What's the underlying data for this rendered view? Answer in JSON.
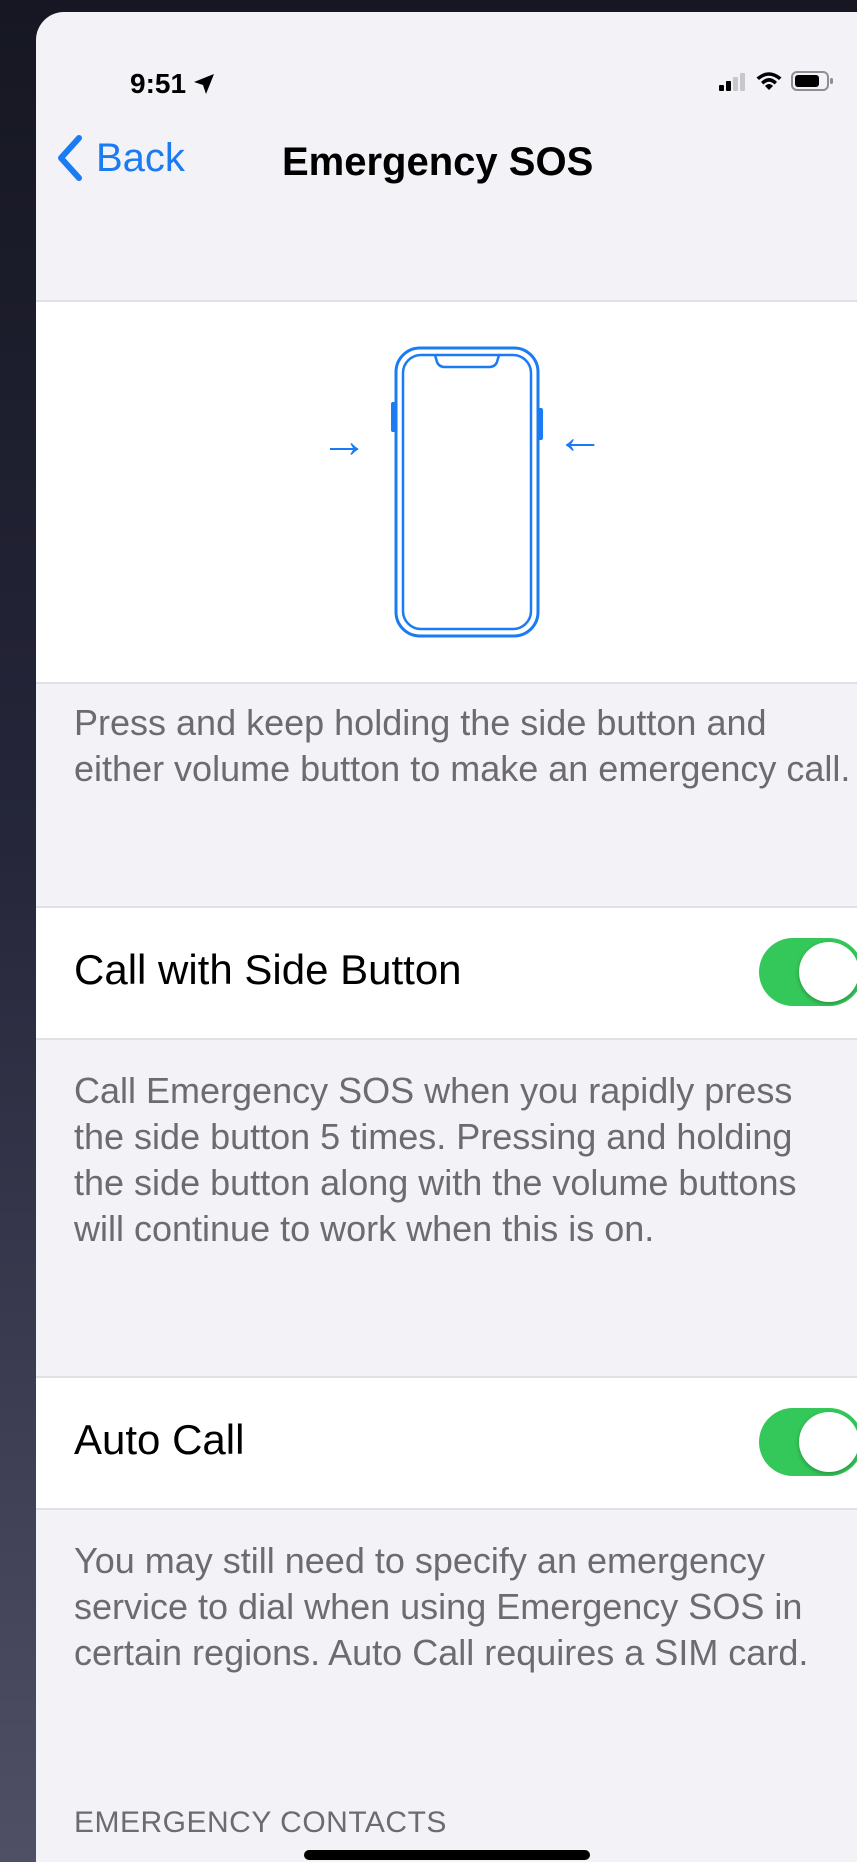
{
  "status_bar": {
    "time": "9:51",
    "location_icon": "location-arrow-icon",
    "signal_icon": "cellular-signal-icon",
    "wifi_icon": "wifi-icon",
    "battery_icon": "battery-icon"
  },
  "nav": {
    "back_label": "Back",
    "back_icon": "chevron-left-icon",
    "title": "Emergency SOS"
  },
  "illustration": {
    "icon": "phone-side-buttons-icon",
    "arrow_right": "→",
    "arrow_left": "←"
  },
  "intro_footer": "Press and keep holding the side button and either volume button to make an emergency call.",
  "settings": [
    {
      "label": "Call with Side Button",
      "on": true,
      "footer": "Call Emergency SOS when you rapidly press the side button 5 times. Pressing and holding the side button along with the volume buttons will continue to work when this is on."
    },
    {
      "label": "Auto Call",
      "on": true,
      "footer": "You may still need to specify an emergency service to dial when using Emergency SOS in certain regions. Auto Call requires a SIM card."
    }
  ],
  "section_header": "EMERGENCY CONTACTS",
  "colors": {
    "accent": "#1a7bf2",
    "toggle_on": "#34c759",
    "background": "#f2f2f7",
    "footer_text": "#6b6b70"
  }
}
